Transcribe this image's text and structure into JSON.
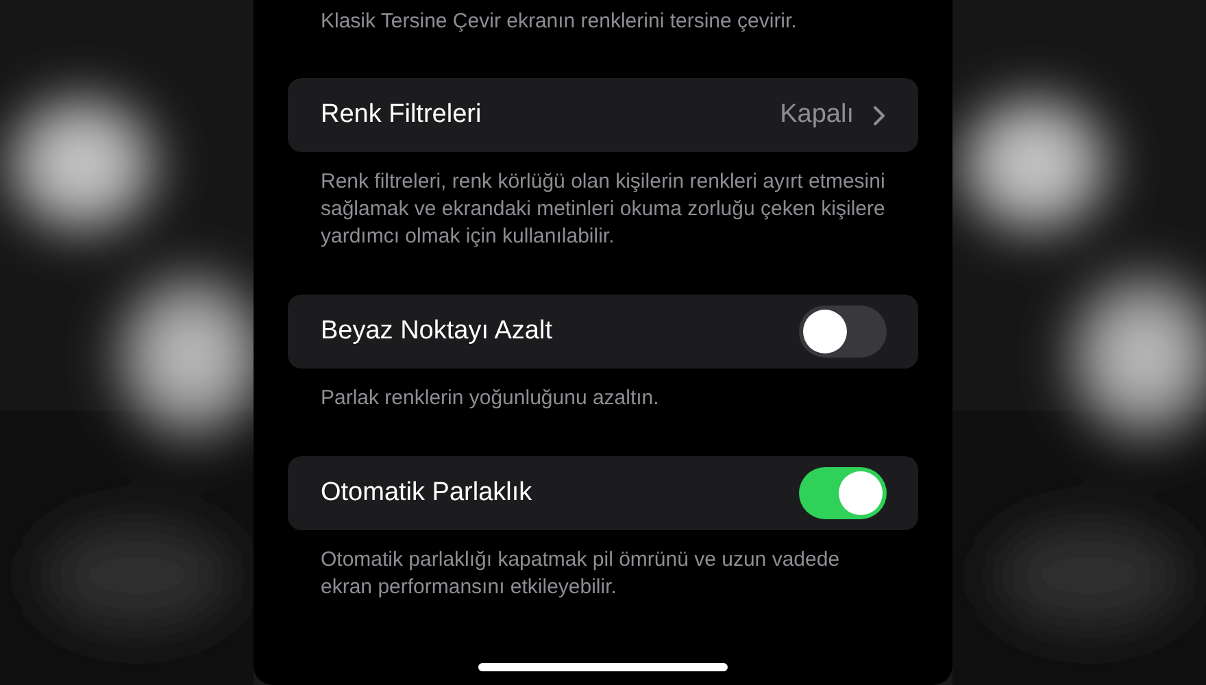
{
  "top_note": "Klasik Tersine Çevir ekranın renklerini tersine çevirir.",
  "sections": [
    {
      "kind": "link",
      "label": "Renk Filtreleri",
      "value": "Kapalı",
      "note": "Renk filtreleri, renk körlüğü olan kişilerin renkleri ayırt etmesini sağlamak ve ekrandaki metinleri okuma zorluğu çeken kişilere yardımcı olmak için kullanılabilir."
    },
    {
      "kind": "toggle",
      "label": "Beyaz Noktayı Azalt",
      "on": false,
      "note": "Parlak renklerin yoğunluğunu azaltın."
    },
    {
      "kind": "toggle",
      "label": "Otomatik Parlaklık",
      "on": true,
      "note": "Otomatik parlaklığı kapatmak pil ömrünü ve uzun vadede ekran performansını etkileyebilir."
    }
  ]
}
